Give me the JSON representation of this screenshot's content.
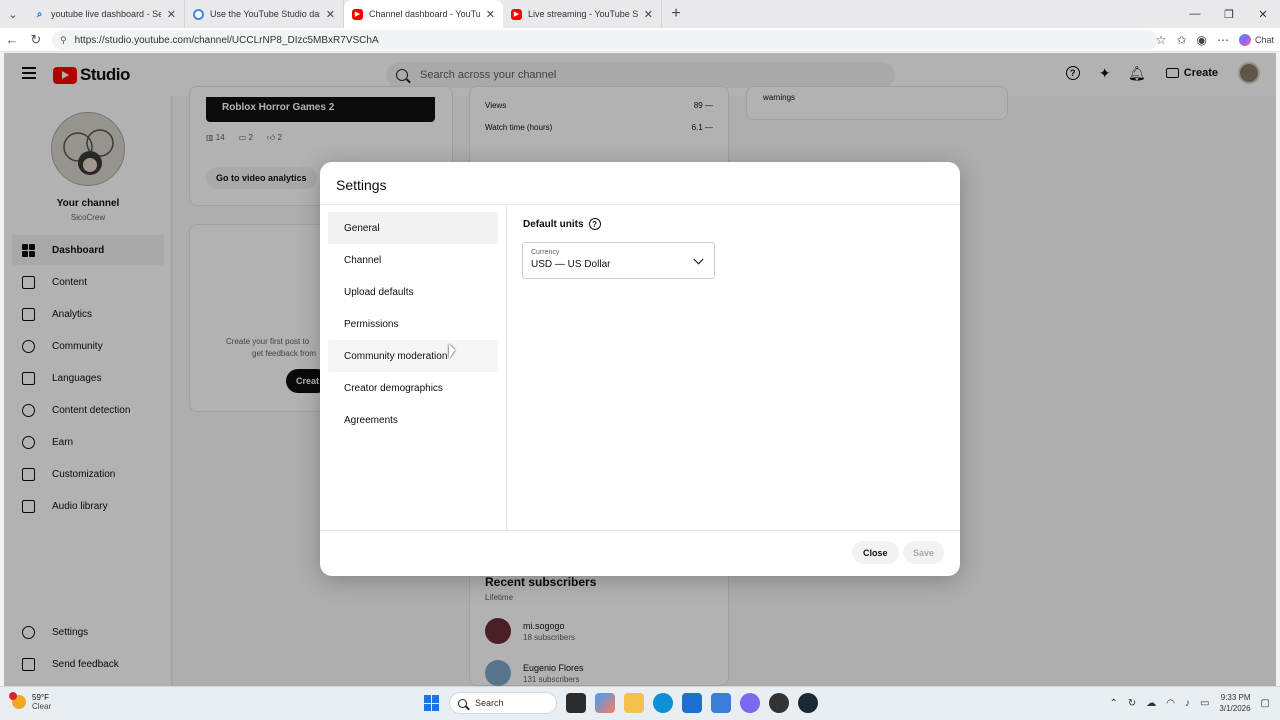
{
  "browser": {
    "tabs": [
      {
        "title": "youtube live dashboard - Search",
        "icon": "search-icon",
        "active": false
      },
      {
        "title": "Use the YouTube Studio dashboard",
        "icon": "google-icon",
        "active": false
      },
      {
        "title": "Channel dashboard - YouTube Studio",
        "icon": "youtube-icon",
        "active": true
      },
      {
        "title": "Live streaming - YouTube Studio",
        "icon": "youtube-icon",
        "active": false
      }
    ],
    "url": "https://studio.youtube.com/channel/UCCLrNP8_DIzc5MBxR7VSChA",
    "chat_label": "Chat"
  },
  "header": {
    "logo_text": "Studio",
    "search_placeholder": "Search across your channel",
    "create_label": "Create"
  },
  "sidebar": {
    "channel_title": "Your channel",
    "channel_handle": "SicoCrew",
    "items": [
      {
        "label": "Dashboard",
        "icon": "dashboard-icon",
        "active": true
      },
      {
        "label": "Content",
        "icon": "content-icon"
      },
      {
        "label": "Analytics",
        "icon": "analytics-icon"
      },
      {
        "label": "Community",
        "icon": "community-icon"
      },
      {
        "label": "Languages",
        "icon": "languages-icon"
      },
      {
        "label": "Content detection",
        "icon": "content-detection-icon"
      },
      {
        "label": "Earn",
        "icon": "earn-icon"
      },
      {
        "label": "Customization",
        "icon": "customization-icon"
      },
      {
        "label": "Audio library",
        "icon": "audio-library-icon"
      }
    ],
    "bottom_items": [
      {
        "label": "Settings",
        "icon": "gear-icon"
      },
      {
        "label": "Send feedback",
        "icon": "feedback-icon"
      }
    ]
  },
  "background": {
    "video_title": "Roblox Horror Games 2",
    "video_stats": {
      "views": "14",
      "comments": "2",
      "likes": "2"
    },
    "goto_analytics": "Go to video analytics",
    "create_post_text": "Create your first post to",
    "create_post_text2": "get feedback from",
    "create_btn_partial": "Creat",
    "metrics": [
      {
        "label": "Views",
        "value": "89",
        "trend": "—"
      },
      {
        "label": "Watch time (hours)",
        "value": "6.1",
        "trend": "—"
      }
    ],
    "warnings_text": "warnings",
    "recent_subscribers_title": "Recent subscribers",
    "recent_subscribers_period": "Lifetime",
    "subscribers": [
      {
        "name": "mi.sogogo",
        "count": "18 subscribers"
      },
      {
        "name": "Eugenio Flores",
        "count": "131 subscribers"
      }
    ]
  },
  "dialog": {
    "title": "Settings",
    "nav": [
      {
        "label": "General",
        "active": true
      },
      {
        "label": "Channel"
      },
      {
        "label": "Upload defaults"
      },
      {
        "label": "Permissions"
      },
      {
        "label": "Community moderation",
        "hover": true
      },
      {
        "label": "Creator demographics"
      },
      {
        "label": "Agreements"
      }
    ],
    "default_units_label": "Default units",
    "currency_label": "Currency",
    "currency_value": "USD — US Dollar",
    "close_label": "Close",
    "save_label": "Save"
  },
  "taskbar": {
    "weather_temp": "59°F",
    "weather_condition": "Clear",
    "search_label": "Search",
    "time": "9:33 PM",
    "date": "3/1/2026"
  },
  "colors": {
    "brand_red": "#ff0000",
    "overlay": "rgba(0,0,0,0.30)",
    "active_bg": "#f2f2f2"
  }
}
